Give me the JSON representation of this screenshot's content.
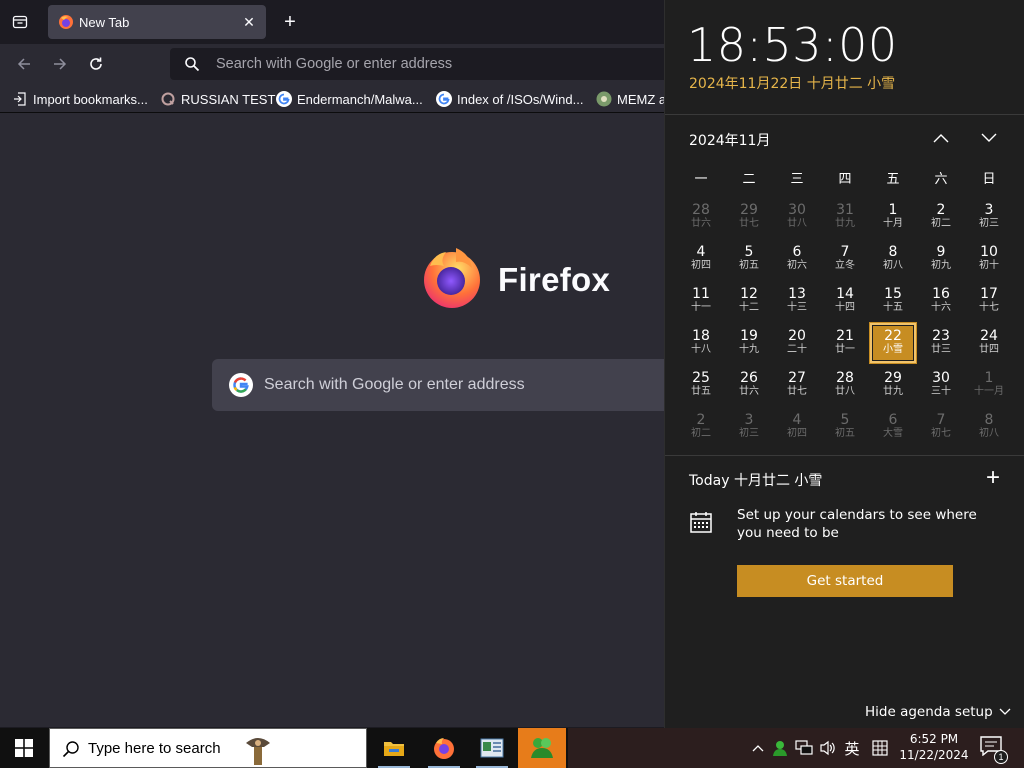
{
  "firefox": {
    "tab": {
      "title": "New Tab",
      "close": "✕"
    },
    "new_tab": "+",
    "urlbar": {
      "placeholder": "Search with Google or enter address"
    },
    "bookmarks": [
      {
        "label": "Import bookmarks...",
        "icon": "import-icon"
      },
      {
        "label": "RUSSIAN TEST",
        "icon": "site-favicon"
      },
      {
        "label": "Endermanch/Malwa...",
        "icon": "google-icon"
      },
      {
        "label": "Index of /ISOs/Wind...",
        "icon": "google-icon"
      },
      {
        "label": "MEMZ a",
        "icon": "site-favicon"
      }
    ],
    "brand": "Firefox",
    "search": {
      "placeholder": "Search with Google or enter address"
    }
  },
  "flyout": {
    "time": "18:53:00",
    "long_date": "2024年11月22日 十月廿二 小雪",
    "month_title": "2024年11月",
    "weekdays": [
      "一",
      "二",
      "三",
      "四",
      "五",
      "六",
      "日"
    ],
    "days": [
      {
        "d": "28",
        "l": "廿六",
        "dim": true
      },
      {
        "d": "29",
        "l": "廿七",
        "dim": true
      },
      {
        "d": "30",
        "l": "廿八",
        "dim": true
      },
      {
        "d": "31",
        "l": "廿九",
        "dim": true
      },
      {
        "d": "1",
        "l": "十月"
      },
      {
        "d": "2",
        "l": "初二"
      },
      {
        "d": "3",
        "l": "初三"
      },
      {
        "d": "4",
        "l": "初四"
      },
      {
        "d": "5",
        "l": "初五"
      },
      {
        "d": "6",
        "l": "初六"
      },
      {
        "d": "7",
        "l": "立冬"
      },
      {
        "d": "8",
        "l": "初八"
      },
      {
        "d": "9",
        "l": "初九"
      },
      {
        "d": "10",
        "l": "初十"
      },
      {
        "d": "11",
        "l": "十一"
      },
      {
        "d": "12",
        "l": "十二"
      },
      {
        "d": "13",
        "l": "十三"
      },
      {
        "d": "14",
        "l": "十四"
      },
      {
        "d": "15",
        "l": "十五"
      },
      {
        "d": "16",
        "l": "十六"
      },
      {
        "d": "17",
        "l": "十七"
      },
      {
        "d": "18",
        "l": "十八"
      },
      {
        "d": "19",
        "l": "十九"
      },
      {
        "d": "20",
        "l": "二十"
      },
      {
        "d": "21",
        "l": "廿一"
      },
      {
        "d": "22",
        "l": "小雪",
        "today": true
      },
      {
        "d": "23",
        "l": "廿三"
      },
      {
        "d": "24",
        "l": "廿四"
      },
      {
        "d": "25",
        "l": "廿五"
      },
      {
        "d": "26",
        "l": "廿六"
      },
      {
        "d": "27",
        "l": "廿七"
      },
      {
        "d": "28",
        "l": "廿八"
      },
      {
        "d": "29",
        "l": "廿九"
      },
      {
        "d": "30",
        "l": "三十"
      },
      {
        "d": "1",
        "l": "十一月",
        "dim": true
      },
      {
        "d": "2",
        "l": "初二",
        "dim": true
      },
      {
        "d": "3",
        "l": "初三",
        "dim": true
      },
      {
        "d": "4",
        "l": "初四",
        "dim": true
      },
      {
        "d": "5",
        "l": "初五",
        "dim": true
      },
      {
        "d": "6",
        "l": "大雪",
        "dim": true
      },
      {
        "d": "7",
        "l": "初七",
        "dim": true
      },
      {
        "d": "8",
        "l": "初八",
        "dim": true
      }
    ],
    "agenda_head": "Today 十月廿二 小雪",
    "add_event": "+",
    "setup_text": "Set up your calendars to see where you need to be",
    "get_started": "Get started",
    "hide_agenda": "Hide agenda setup"
  },
  "taskbar": {
    "search_placeholder": "Type here to search",
    "ime": "英",
    "time": "6:52 PM",
    "date": "11/22/2024",
    "notification_count": "1"
  },
  "colors": {
    "accent": "#c78d22",
    "firefox_bg": "#2b2a33",
    "flyout_bg": "#1f1f1f",
    "taskbar_active": "#e77c1a"
  }
}
